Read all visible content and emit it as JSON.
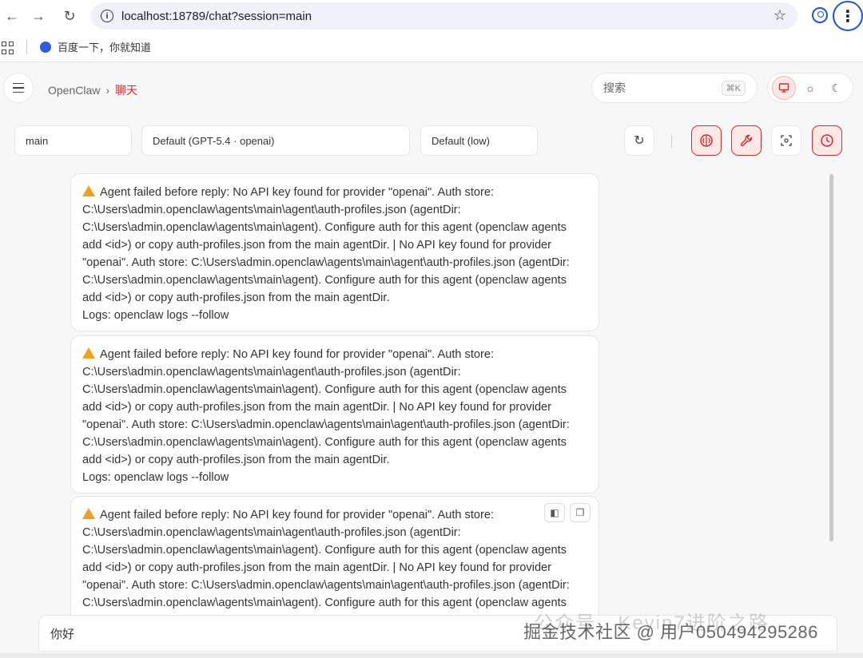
{
  "browser": {
    "url": "localhost:18789/chat?session=main",
    "bookmark_label": "百度一下，你就知道"
  },
  "header": {
    "brand": "OpenClaw",
    "separator": "›",
    "current": "聊天",
    "search_placeholder": "搜索",
    "search_shortcut": "⌘K"
  },
  "toolbar": {
    "session": "main",
    "model": "Default (GPT-5.4 · openai)",
    "thinking": "Default (low)"
  },
  "messages": [
    {
      "text": "Agent failed before reply: No API key found for provider \"openai\". Auth store: C:\\Users\\admin.openclaw\\agents\\main\\agent\\auth-profiles.json (agentDir: C:\\Users\\admin.openclaw\\agents\\main\\agent). Configure auth for this agent (openclaw agents add <id>) or copy auth-profiles.json from the main agentDir. | No API key found for provider \"openai\". Auth store: C:\\Users\\admin.openclaw\\agents\\main\\agent\\auth-profiles.json (agentDir: C:\\Users\\admin.openclaw\\agents\\main\\agent). Configure auth for this agent (openclaw agents add <id>) or copy auth-profiles.json from the main agentDir.",
      "logs": "Logs: openclaw logs --follow"
    },
    {
      "text": "Agent failed before reply: No API key found for provider \"openai\". Auth store: C:\\Users\\admin.openclaw\\agents\\main\\agent\\auth-profiles.json (agentDir: C:\\Users\\admin.openclaw\\agents\\main\\agent). Configure auth for this agent (openclaw agents add <id>) or copy auth-profiles.json from the main agentDir. | No API key found for provider \"openai\". Auth store: C:\\Users\\admin.openclaw\\agents\\main\\agent\\auth-profiles.json (agentDir: C:\\Users\\admin.openclaw\\agents\\main\\agent). Configure auth for this agent (openclaw agents add <id>) or copy auth-profiles.json from the main agentDir.",
      "logs": "Logs: openclaw logs --follow"
    },
    {
      "text": "Agent failed before reply: No API key found for provider \"openai\". Auth store: C:\\Users\\admin.openclaw\\agents\\main\\agent\\auth-profiles.json (agentDir: C:\\Users\\admin.openclaw\\agents\\main\\agent). Configure auth for this agent (openclaw agents add <id>) or copy auth-profiles.json from the main agentDir. | No API key found for provider \"openai\". Auth store: C:\\Users\\admin.openclaw\\agents\\main\\agent\\auth-profiles.json (agentDir: C:\\Users\\admin.openclaw\\agents\\main\\agent). Configure auth for this agent (openclaw agents add",
      "logs": ""
    }
  ],
  "composer": {
    "value": "你好"
  },
  "watermark": {
    "line1": "公众号 · Kevin7进阶之路",
    "line2": "掘金技术社区 @ 用户050494295286"
  },
  "colors": {
    "accent": "#d6282f",
    "warning": "#f0a020"
  }
}
